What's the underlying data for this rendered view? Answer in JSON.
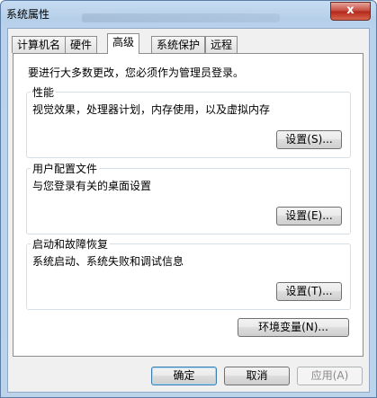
{
  "window": {
    "title": "系统属性",
    "close_label": "x"
  },
  "tabs": [
    {
      "label": "计算机名"
    },
    {
      "label": "硬件"
    },
    {
      "label": "高级"
    },
    {
      "label": "系统保护"
    },
    {
      "label": "远程"
    }
  ],
  "advanced": {
    "intro": "要进行大多数更改，您必须作为管理员登录。",
    "performance": {
      "title": "性能",
      "desc": "视觉效果，处理器计划，内存使用，以及虚拟内存",
      "button": "设置(S)..."
    },
    "profiles": {
      "title": "用户配置文件",
      "desc": "与您登录有关的桌面设置",
      "button": "设置(E)..."
    },
    "startup": {
      "title": "启动和故障恢复",
      "desc": "系统启动、系统失败和调试信息",
      "button": "设置(T)..."
    },
    "env_button": "环境变量(N)..."
  },
  "footer": {
    "ok": "确定",
    "cancel": "取消",
    "apply": "应用(A)"
  }
}
